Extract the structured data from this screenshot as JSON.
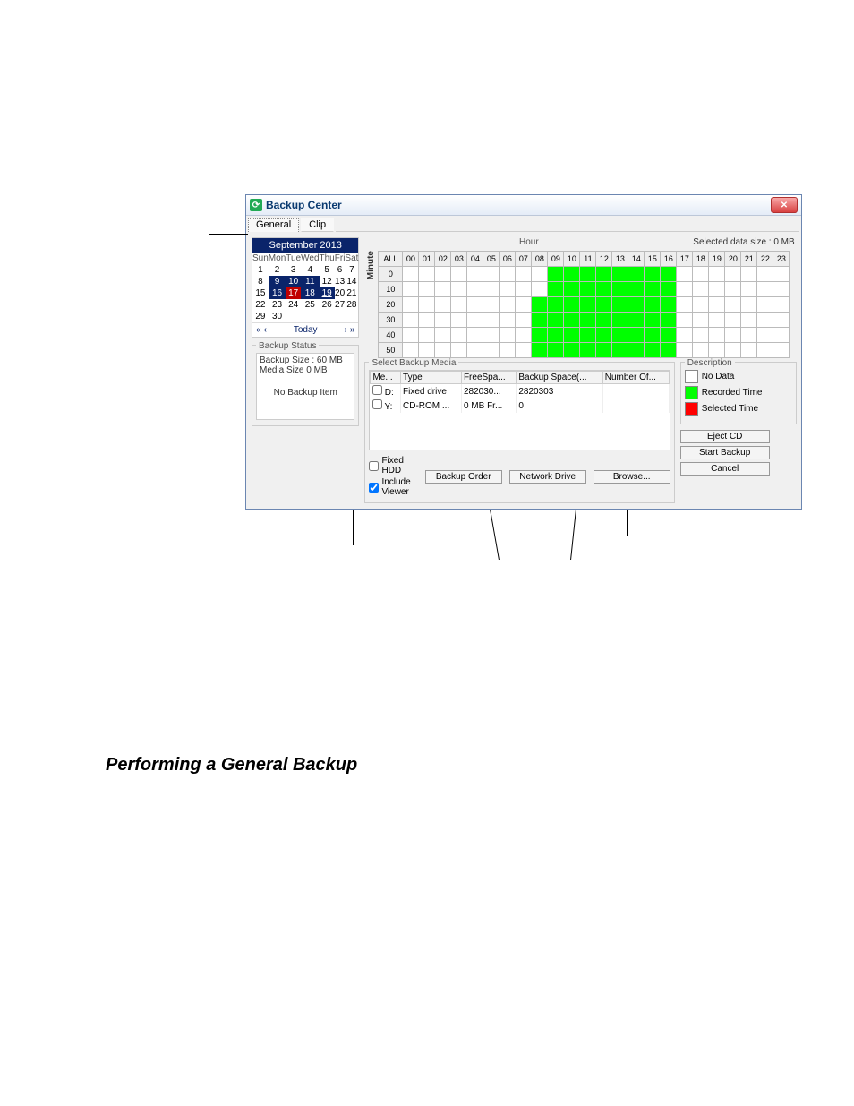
{
  "window": {
    "title": "Backup Center",
    "close_tooltip": "Close"
  },
  "tabs": {
    "general": "General",
    "clip": "Clip"
  },
  "calendar": {
    "header": "September 2013",
    "dow": [
      "Sun",
      "Mon",
      "Tue",
      "Wed",
      "Thu",
      "Fri",
      "Sat"
    ],
    "weeks": [
      [
        "1",
        "2",
        "3",
        "4",
        "5",
        "6",
        "7"
      ],
      [
        "8",
        "9",
        "10",
        "11",
        "12",
        "13",
        "14"
      ],
      [
        "15",
        "16",
        "17",
        "18",
        "19",
        "20",
        "21"
      ],
      [
        "22",
        "23",
        "24",
        "25",
        "26",
        "27",
        "28"
      ],
      [
        "29",
        "30",
        "",
        "",
        "",
        "",
        ""
      ]
    ],
    "selected": [
      "9",
      "10",
      "11",
      "16",
      "18",
      "19"
    ],
    "red": [
      "17"
    ],
    "today": "19",
    "today_label": "Today"
  },
  "backup_status": {
    "legend": "Backup Status",
    "size_line": "Backup Size : 60 MB",
    "media_line": "Media Size 0 MB",
    "no_item": "No Backup Item"
  },
  "time_panel": {
    "hour_label": "Hour",
    "minute_label": "Minute",
    "selected_size": "Selected data size : 0 MB",
    "all_label": "ALL",
    "hours": [
      "00",
      "01",
      "02",
      "03",
      "04",
      "05",
      "06",
      "07",
      "08",
      "09",
      "10",
      "11",
      "12",
      "13",
      "14",
      "15",
      "16",
      "17",
      "18",
      "19",
      "20",
      "21",
      "22",
      "23"
    ],
    "minute_rows": [
      "0",
      "10",
      "20",
      "30",
      "40",
      "50"
    ],
    "recorded_cols_start": 9,
    "recorded_cols_end": 16,
    "partial_col8_row_from": 2
  },
  "media": {
    "legend": "Select Backup Media",
    "columns": [
      "Me...",
      "Type",
      "FreeSpa...",
      "Backup Space(...",
      "Number Of..."
    ],
    "rows": [
      {
        "drive": "D:",
        "type": "Fixed drive",
        "free": "282030...",
        "backup": "2820303",
        "num": ""
      },
      {
        "drive": "Y:",
        "type": "CD-ROM ...",
        "free": "0 MB Fr...",
        "backup": "0",
        "num": ""
      }
    ]
  },
  "description": {
    "legend": "Description",
    "no_data": "No Data",
    "recorded": "Recorded Time",
    "selected": "Selected Time"
  },
  "options": {
    "fixed_hdd": "Fixed HDD",
    "include_viewer": "Include Viewer"
  },
  "buttons": {
    "backup_order": "Backup Order",
    "network_drive": "Network Drive",
    "browse": "Browse...",
    "eject": "Eject CD",
    "start": "Start Backup",
    "cancel": "Cancel"
  },
  "heading": "Performing a General Backup"
}
